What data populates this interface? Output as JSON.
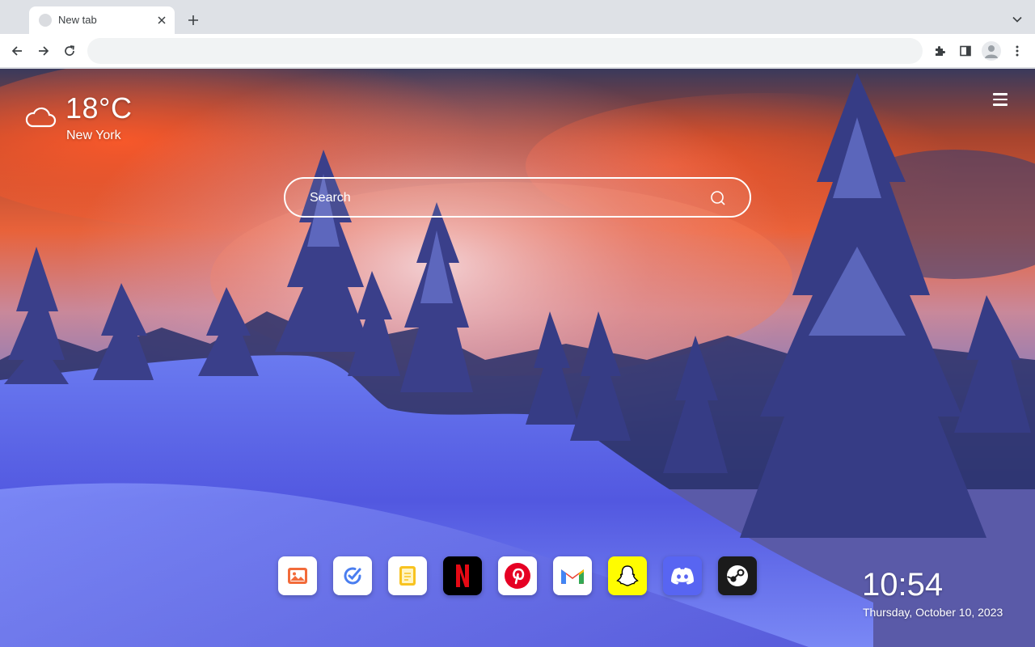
{
  "browser": {
    "tab": {
      "title": "New tab"
    },
    "toolbar": {
      "address_value": "",
      "address_placeholder": ""
    },
    "icons": [
      "favicon-icon",
      "close-icon",
      "plus-icon",
      "chevron-down-icon",
      "back-icon",
      "forward-icon",
      "reload-icon",
      "extensions-icon",
      "side-panel-icon",
      "profile-icon",
      "more-vert-icon"
    ]
  },
  "weather": {
    "temperature": "18°C",
    "city": "New York",
    "icon": "cloud-icon"
  },
  "search": {
    "placeholder": "Search",
    "value": ""
  },
  "menu": {
    "icon": "hamburger-menu-icon"
  },
  "shortcuts": [
    {
      "name": "Photos",
      "icon": "photo-gallery-icon",
      "bg": "#ffffff"
    },
    {
      "name": "Tasks",
      "icon": "task-check-icon",
      "bg": "#ffffff"
    },
    {
      "name": "Notes",
      "icon": "notes-icon",
      "bg": "#ffffff"
    },
    {
      "name": "Netflix",
      "icon": "netflix-icon",
      "bg": "#000000"
    },
    {
      "name": "Pinterest",
      "icon": "pinterest-icon",
      "bg": "#ffffff"
    },
    {
      "name": "Gmail",
      "icon": "gmail-icon",
      "bg": "#ffffff"
    },
    {
      "name": "Snapchat",
      "icon": "snapchat-icon",
      "bg": "#fffc00"
    },
    {
      "name": "Discord",
      "icon": "discord-icon",
      "bg": "#5865f2"
    },
    {
      "name": "Steam",
      "icon": "steam-icon",
      "bg": "#1b1b1b"
    }
  ],
  "clock": {
    "time": "10:54",
    "date": "Thursday, October 10, 2023"
  },
  "colors": {
    "accent": "#ffffff",
    "chrome_bg": "#dee1e6",
    "toolbar_bg": "#ffffff"
  }
}
